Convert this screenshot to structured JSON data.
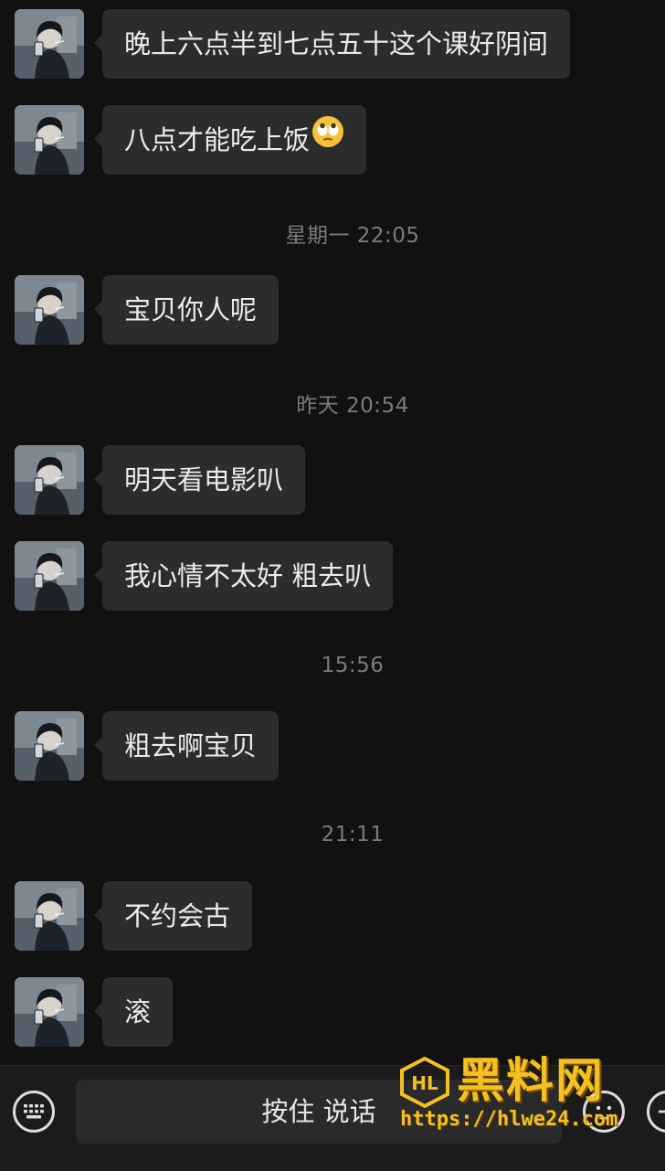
{
  "messages": [
    {
      "text": "晚上六点半到七点五十这个课好阴间"
    },
    {
      "text": "八点才能吃上饭",
      "emoji": "eye-roll-emoji"
    },
    {
      "text": "宝贝你人呢"
    },
    {
      "text": "明天看电影叭"
    },
    {
      "text": "我心情不太好 粗去叭"
    },
    {
      "text": "粗去啊宝贝"
    },
    {
      "text": "不约会古"
    },
    {
      "text": "滚"
    }
  ],
  "timestamps": [
    "星期一 22:05",
    "昨天 20:54",
    "15:56",
    "21:11"
  ],
  "input_bar": {
    "hold_to_talk_label": "按住 说话",
    "left_icon": "keyboard-icon",
    "right_icons": [
      "emoji-icon",
      "plus-icon"
    ]
  },
  "watermark": {
    "title": "黑料网",
    "url": "https://hlwe24.com"
  },
  "colors": {
    "background": "#111111",
    "bubble": "#2c2c2c",
    "timestamp_text": "#7a7a7a",
    "watermark": "#f4c020"
  }
}
